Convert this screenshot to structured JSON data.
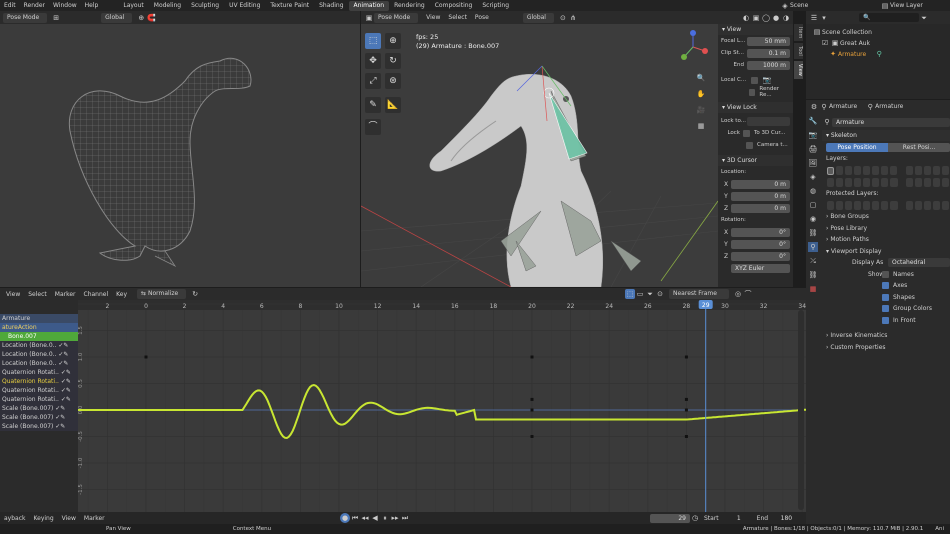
{
  "topbar": {
    "menus": [
      "Edit",
      "Render",
      "Window",
      "Help"
    ],
    "workspaces": [
      "Layout",
      "Modeling",
      "Sculpting",
      "UV Editing",
      "Texture Paint",
      "Shading",
      "Animation",
      "Rendering",
      "Compositing",
      "Scripting"
    ],
    "active_workspace_index": 6,
    "scene": "Scene",
    "view_layer": "View Layer"
  },
  "left_view": {
    "mode": "Pose Mode",
    "orientation": "Global"
  },
  "main_view": {
    "mode": "Pose Mode",
    "menus": [
      "View",
      "Select",
      "Pose"
    ],
    "orientation": "Global",
    "overlay_fps": "fps: 25",
    "overlay_object": "(29) Armature : Bone.007"
  },
  "n_panel": {
    "view_title": "View",
    "focal_label": "Focal L...",
    "focal_value": "50 mm",
    "clip_label": "Clip St...",
    "clip_start": "0.1 m",
    "end_label": "End",
    "clip_end": "1000 m",
    "local_camera": "Local C...",
    "render_region": "Render Re...",
    "view_lock_title": "View Lock",
    "lock_to": "Lock to...",
    "lock": "Lock",
    "to_3d_cursor": "To 3D Cur...",
    "camera_to": "Camera t...",
    "cursor_title": "3D Cursor",
    "location_label": "Location:",
    "rotation_label": "Rotation:",
    "axis_x": "X",
    "axis_y": "Y",
    "axis_z": "Z",
    "loc_x": "0 m",
    "loc_y": "0 m",
    "loc_z": "0 m",
    "rot_x": "0°",
    "rot_y": "0°",
    "rot_z": "0°",
    "rot_mode": "XYZ Euler",
    "tabs": [
      "Item",
      "Tool",
      "View"
    ]
  },
  "outliner": {
    "items": [
      "Scene Collection",
      "Great Auk",
      "Armature"
    ]
  },
  "properties": {
    "breadcrumb_a": "Armature",
    "breadcrumb_b": "Armature",
    "name": "Armature",
    "skeleton": "Skeleton",
    "pose_position": "Pose Position",
    "rest_position": "Rest Posi...",
    "layers": "Layers:",
    "protected_layers": "Protected Layers:",
    "sections": [
      "Bone Groups",
      "Pose Library",
      "Motion Paths",
      "Viewport Display"
    ],
    "display_as_label": "Display As",
    "display_as_value": "Octahedral",
    "show_label": "Show",
    "show_options": [
      {
        "label": "Names",
        "on": false
      },
      {
        "label": "Axes",
        "on": true
      },
      {
        "label": "Shapes",
        "on": true
      },
      {
        "label": "Group Colors",
        "on": true
      },
      {
        "label": "In Front",
        "on": true
      }
    ],
    "sections2": [
      "Inverse Kinematics",
      "Custom Properties"
    ]
  },
  "graph_editor": {
    "menus": [
      "View",
      "Select",
      "Marker",
      "Channel",
      "Key"
    ],
    "normalize": "Normalize",
    "interp": "Nearest Frame",
    "frame_ticks": [
      "2",
      "0",
      "2",
      "4",
      "6",
      "8",
      "10",
      "12",
      "14",
      "16",
      "18",
      "20",
      "22",
      "24",
      "26",
      "28",
      "29",
      "30",
      "32",
      "34"
    ],
    "value_ticks": [
      "1.5",
      "1.0",
      "0.5",
      "0.0",
      "-0.5",
      "-1.0",
      "-1.5"
    ],
    "current_frame": 29,
    "channels": [
      {
        "label": "Armature",
        "type": "obj"
      },
      {
        "label": "atureAction",
        "type": "action"
      },
      {
        "label": "Bone.007",
        "type": "group"
      },
      {
        "label": "Location (Bone.0..",
        "type": "ch"
      },
      {
        "label": "Location (Bone.0..",
        "type": "ch"
      },
      {
        "label": "Location (Bone.0..",
        "type": "ch"
      },
      {
        "label": "Quaternion Rotati..",
        "type": "ch"
      },
      {
        "label": "Quaternion Rotati..",
        "type": "chy"
      },
      {
        "label": "Quaternion Rotati..",
        "type": "ch"
      },
      {
        "label": "Quaternion Rotati..",
        "type": "ch"
      },
      {
        "label": "Scale (Bone.007)",
        "type": "ch"
      },
      {
        "label": "Scale (Bone.007)",
        "type": "ch"
      },
      {
        "label": "Scale (Bone.007)",
        "type": "ch"
      }
    ]
  },
  "timeline": {
    "menus": [
      "ayback",
      "Keying",
      "View",
      "Marker"
    ],
    "frame": "29",
    "start_label": "Start",
    "start": "1",
    "end_label": "End",
    "end": "180"
  },
  "statusbar": {
    "left": "Pan View",
    "mid": "Context Menu",
    "stats": "Armature | Bones:1/18 | Objects:0/1 | Memory: 110.7 MiB | 2.90.1",
    "right": "Ani"
  },
  "colors": {
    "accent": "#4c78b8",
    "curve": "#c8e632",
    "playhead": "#5a8fd6",
    "selected_channel": "#4fa83a"
  }
}
